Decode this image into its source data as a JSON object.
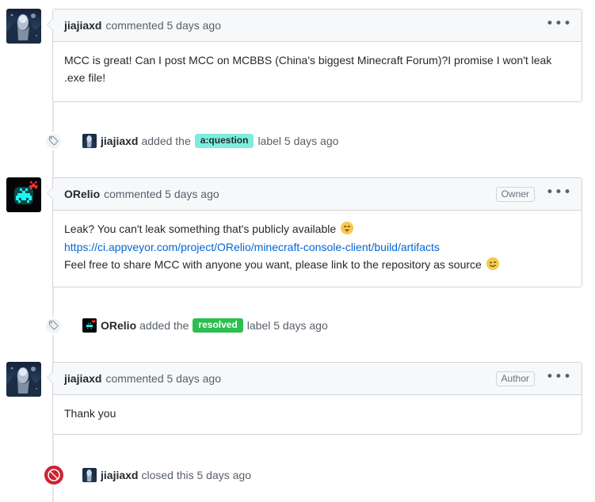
{
  "thread": {
    "comments": [
      {
        "id": "comment-1",
        "author": "jiajiaxd",
        "action": "commented 5 days ago",
        "badge": null,
        "kebab": "•••",
        "avatar": "jiajiaxd-avatar",
        "body_lines": [
          "MCC is great! Can I post MCC on MCBBS (China's biggest Minecraft Forum)?I promise I won't leak .exe file!"
        ]
      },
      {
        "id": "comment-2",
        "author": "ORelio",
        "action": "commented 5 days ago",
        "badge": "Owner",
        "kebab": "•••",
        "avatar": "orelio-avatar",
        "body_lines": [
          "Leak? You can't leak something that's publicly available ",
          "https://ci.appveyor.com/project/ORelio/minecraft-console-client/build/artifacts",
          "Feel free to share MCC with anyone you want, please link to the repository as source "
        ],
        "link_text": "https://ci.appveyor.com/project/ORelio/minecraft-console-client/build/artifacts",
        "emoji_1": "face-savoring-food",
        "emoji_2": "winking-face"
      },
      {
        "id": "comment-3",
        "author": "jiajiaxd",
        "action": "commented 5 days ago",
        "badge": "Author",
        "kebab": "•••",
        "avatar": "jiajiaxd-avatar",
        "body_lines": [
          "Thank you"
        ]
      }
    ],
    "events": [
      {
        "id": "event-label-question",
        "icon": "tag-icon",
        "user": "jiajiaxd",
        "avatar": "jiajiaxd-avatar",
        "text_before": "added the",
        "label": "a:question",
        "label_bg": "#7ceedd",
        "label_color": "#24292e",
        "text_after": "label 5 days ago"
      },
      {
        "id": "event-label-resolved",
        "icon": "tag-icon",
        "user": "ORelio",
        "avatar": "orelio-avatar",
        "text_before": "added the",
        "label": "resolved",
        "label_bg": "#2cbe4e",
        "label_color": "#ffffff",
        "text_after": "label 5 days ago"
      },
      {
        "id": "event-closed",
        "icon": "circle-slash-icon",
        "user": "jiajiaxd",
        "avatar": "jiajiaxd-avatar",
        "text_before": "closed this 5 days ago",
        "label": null,
        "text_after": ""
      }
    ]
  },
  "colors": {
    "border": "#d1d5da",
    "header_bg": "#f6f8fa",
    "link": "#0366d6",
    "muted_text": "#586069",
    "closed_red": "#cb2431",
    "rail": "#e1e4e8"
  }
}
